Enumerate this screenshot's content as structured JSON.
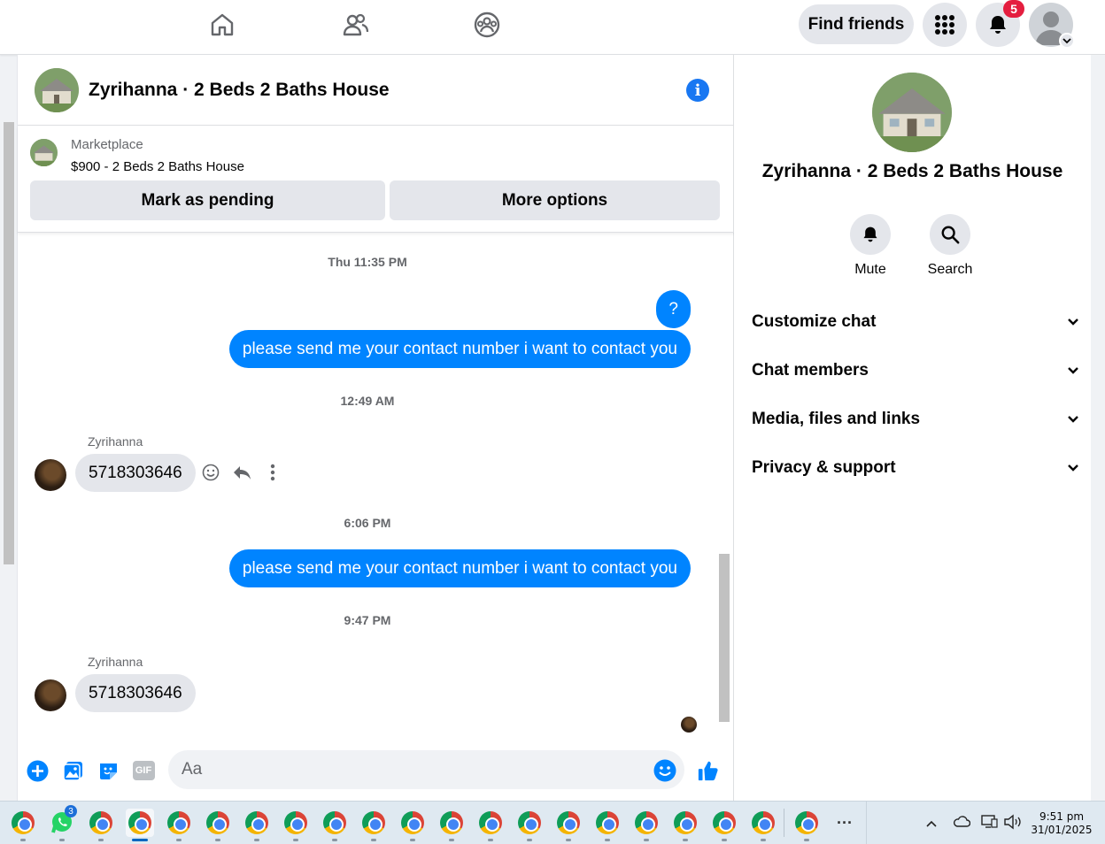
{
  "nav": {
    "find_friends": "Find friends",
    "notification_count": "5"
  },
  "chat": {
    "title": "Zyrihanna · 2 Beds 2 Baths House",
    "listing": {
      "source": "Marketplace",
      "title": "$900 - 2 Beds 2 Baths House",
      "mark_pending": "Mark as pending",
      "more_options": "More options"
    },
    "messages": [
      {
        "type": "timestamp",
        "text": "Thu 11:35 PM"
      },
      {
        "type": "out",
        "text": "?"
      },
      {
        "type": "out",
        "text": "please send me your contact number i want to contact you"
      },
      {
        "type": "timestamp",
        "text": "12:49 AM"
      },
      {
        "type": "sender",
        "text": "Zyrihanna"
      },
      {
        "type": "in",
        "text": "5718303646"
      },
      {
        "type": "timestamp",
        "text": "6:06 PM"
      },
      {
        "type": "out",
        "text": "please send me your contact number i want to contact you"
      },
      {
        "type": "timestamp",
        "text": "9:47 PM"
      },
      {
        "type": "sender",
        "text": "Zyrihanna"
      },
      {
        "type": "in",
        "text": "5718303646"
      }
    ],
    "composer": {
      "placeholder": "Aa",
      "gif_label": "GIF"
    }
  },
  "right_panel": {
    "title": "Zyrihanna · 2 Beds 2 Baths House",
    "actions": [
      {
        "label": "Mute",
        "icon": "bell-icon"
      },
      {
        "label": "Search",
        "icon": "search-icon"
      }
    ],
    "sections": [
      {
        "label": "Customize chat"
      },
      {
        "label": "Chat members"
      },
      {
        "label": "Media, files and links"
      },
      {
        "label": "Privacy & support"
      }
    ]
  },
  "taskbar": {
    "whatsapp_badge": "3",
    "overflow": "···",
    "time": "9:51 pm",
    "date": "31/01/2025"
  },
  "colors": {
    "accent": "#0084ff",
    "fb_blue": "#1877f2",
    "badge_red": "#e41e3f"
  }
}
